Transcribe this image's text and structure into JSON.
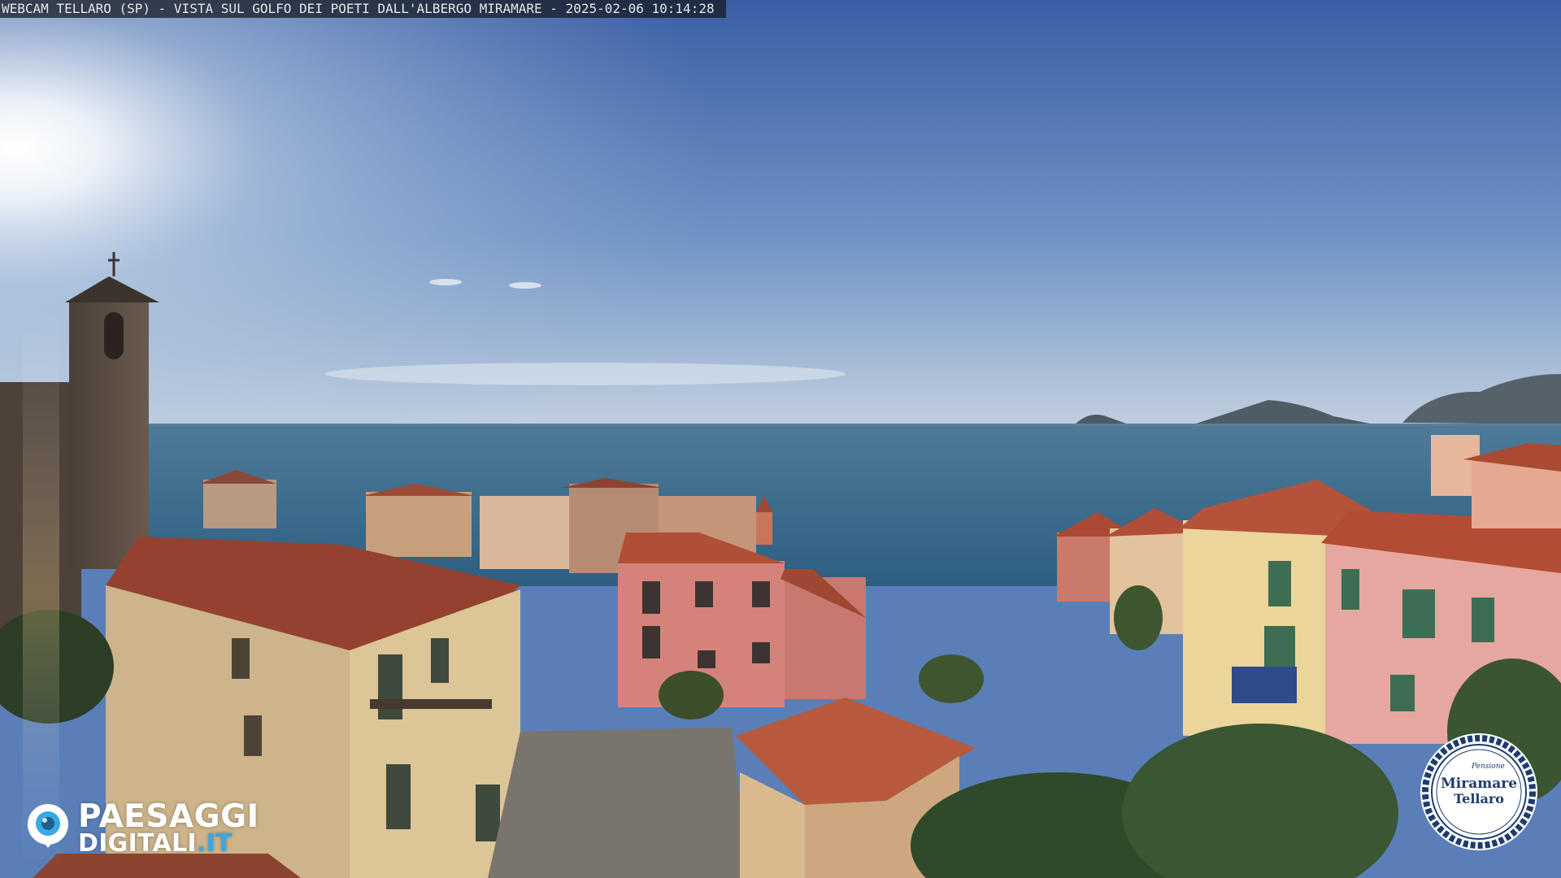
{
  "caption": {
    "text": "WEBCAM TELLARO (SP) - VISTA SUL GOLFO DEI POETI DALL'ALBERGO MIRAMARE - 2025-02-06 10:14:28"
  },
  "brand": {
    "line1": "PAESAGGI",
    "line2_main": "DIGITALI",
    "line2_tld": ".IT",
    "icon": "camera-lens-icon",
    "accent": "#38a8e6"
  },
  "seal": {
    "small_text": "Pensione",
    "name": "Miramare",
    "place": "Tellaro",
    "ring_color": "#1e3c6e"
  },
  "scene": {
    "sky_top": "#3e62a8",
    "sky_horizon": "#b9c9dc",
    "sea": "#3f6d8e",
    "roof": "#b9563a",
    "wall_pink": "#d9847a",
    "wall_yellow": "#e4c98f"
  }
}
